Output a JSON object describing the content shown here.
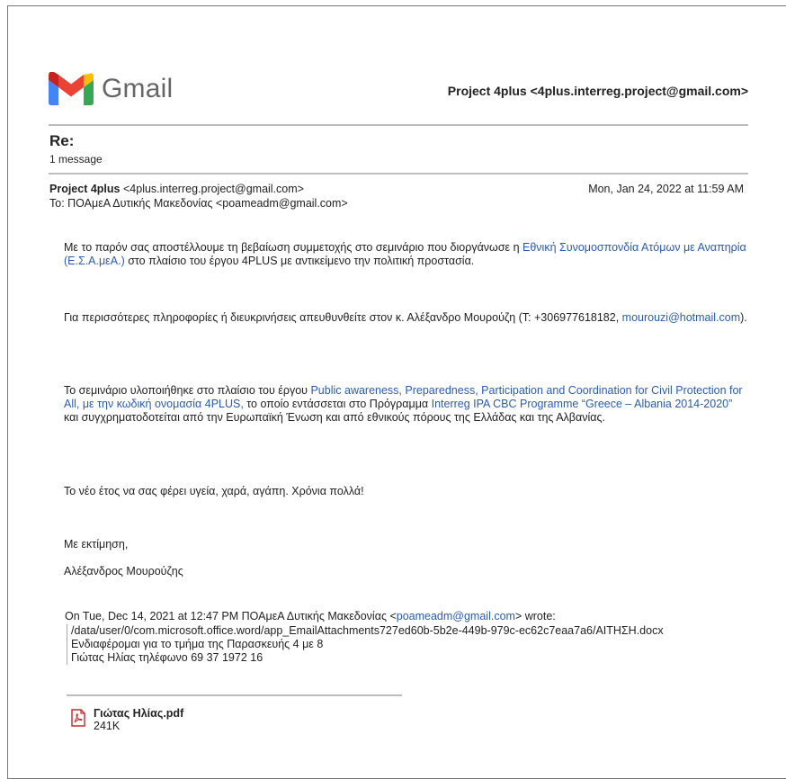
{
  "header": {
    "logo_text": "Gmail",
    "from_account": "Project 4plus <4plus.interreg.project@gmail.com>"
  },
  "thread": {
    "subject": "Re:",
    "message_count": "1 message"
  },
  "message": {
    "sender_name": "Project 4plus",
    "sender_email": "<4plus.interreg.project@gmail.com>",
    "date": "Mon, Jan 24, 2022 at 11:59 AM",
    "to": "To: ΠΟΑμεΑ Δυτικής Μακεδονίας <poameadm@gmail.com>"
  },
  "body": {
    "p1_text_1": "Με το παρόν σας αποστέλλουμε τη βεβαίωση συμμετοχής στο σεμινάριο που διοργάνωσε η ",
    "p1_link": "Εθνική Συνομοσπονδία Ατόμων με Αναπηρία (Ε.Σ.Α.μεΑ.)",
    "p1_text_2": " στο πλαίσιο του έργου 4PLUS με αντικείμενο την πολιτική προστασία.",
    "p2_text_1": "Για περισσότερες πληροφορίες ή διευκρινήσεις απευθυνθείτε στον κ. Αλέξανδρο Μουρούζη (Τ: +306977618182, ",
    "p2_link": "mourouzi@hotmail.com",
    "p2_text_2": ").",
    "p3_text_1": "Το σεμινάριο υλοποιήθηκε στο πλαίσιο του έργου ",
    "p3_link_1": "Public awareness, Preparedness, Participation and Coordination for Civil Protection for All, με την κωδική ονομασία 4PLUS,",
    "p3_text_2": " το οποίο εντάσσεται στο Πρόγραμμα ",
    "p3_link_2": "Interreg IPA CBC Programme “Greece – Albania 2014-2020”",
    "p3_text_3": " και συγχρηματοδοτείται από την Ευρωπαϊκή Ένωση και από εθνικούς πόρους της Ελλάδας και της Αλβανίας.",
    "p4": "Το νέο έτος να σας φέρει υγεία, χαρά, αγάπη. Χρόνια πολλά!",
    "closing": "Με εκτίμηση,",
    "signature": "Αλέξανδρος Μουρούζης"
  },
  "quote": {
    "intro_1": "On Tue, Dec 14, 2021 at 12:47 PM ΠΟΑμεΑ Δυτικής Μακεδονίας <",
    "intro_link": "poameadm@gmail.com",
    "intro_2": "> wrote:",
    "line1": "/data/user/0/com.microsoft.office.word/app_EmailAttachments727ed60b-5b2e-449b-979c-ec62c7eaa7a6/ΑΙΤΗΣΗ.docx",
    "line2": "Ενδιαφέρομαι για το τμήμα της Παρασκευής 4 με 8",
    "line3": "Γιώτας Ηλίας τηλέφωνο 69 37 1972 16"
  },
  "attachment": {
    "name": "Γιώτας Ηλίας.pdf",
    "size": "241K",
    "icon": "pdf-file-icon"
  },
  "colors": {
    "link": "#2a5db0",
    "gmail_red": "#ea4335",
    "gmail_blue": "#4285f4",
    "gmail_green": "#34a853",
    "gmail_yellow": "#fbbc04"
  }
}
